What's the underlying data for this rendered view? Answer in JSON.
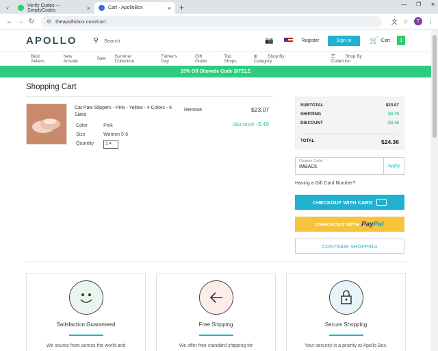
{
  "browser": {
    "tabs": [
      {
        "title": "Verify Codes — SimplyCodes"
      },
      {
        "title": "Cart - ApolloBox"
      }
    ],
    "url": "theapollobox.com/cart"
  },
  "header": {
    "logo": "APOLLO",
    "search_placeholder": "Search",
    "register": "Register",
    "sign_in": "Sign In",
    "cart_label": "Cart",
    "cart_count": "1"
  },
  "nav": {
    "items": [
      "Best Sellers",
      "New Arrivals",
      "Sale",
      "Summer Collection",
      "Father's Day",
      "Gift Guide",
      "Top Shops"
    ],
    "shop_by_category": "Shop By Category",
    "shop_by_collection": "Shop By Collection"
  },
  "banner": "15% Off Sitewide Code SITELE",
  "cart": {
    "title": "Shopping Cart",
    "item": {
      "name": "Cat Paw Slippers - Pink - Yellow - 4 Colors - 6 Sizes",
      "color_label": "Color",
      "color_value": "Pink",
      "size_label": "Size",
      "size_value": "Women 5-6",
      "quantity_label": "Quantity",
      "quantity_value": "1",
      "remove": "Remove",
      "price": "$23.07",
      "discount": "discount -3.46"
    }
  },
  "summary": {
    "subtotal_label": "SUBTOTAL",
    "subtotal": "$23.07",
    "shipping_label": "SHIPPING",
    "shipping": "$4.75",
    "discount_label": "DISCOUNT",
    "discount": "-$3.46",
    "total_label": "TOTAL",
    "total": "$24.36"
  },
  "coupon": {
    "label": "Coupon Code:",
    "value": "IMBACK",
    "apply": "Apply"
  },
  "gift_card": "Having a Gift Card Number?",
  "buttons": {
    "checkout_card": "CHECKOUT WITH CARD",
    "checkout_with": "CHECKOUT WITH",
    "paypal_pay": "Pay",
    "paypal_pal": "Pal",
    "continue": "CONTINUE SHOPPING"
  },
  "features": [
    {
      "title": "Satisfaction Guaranteed",
      "desc": "We source from across the world and"
    },
    {
      "title": "Free Shipping",
      "desc": "We offer free standard shipping for"
    },
    {
      "title": "Secure Shopping",
      "desc": "Your security is a priority at Apollo Box."
    }
  ],
  "colors": {
    "accent": "#20b1d0",
    "green": "#2ecc82",
    "paypal_yellow": "#f7c33b"
  }
}
